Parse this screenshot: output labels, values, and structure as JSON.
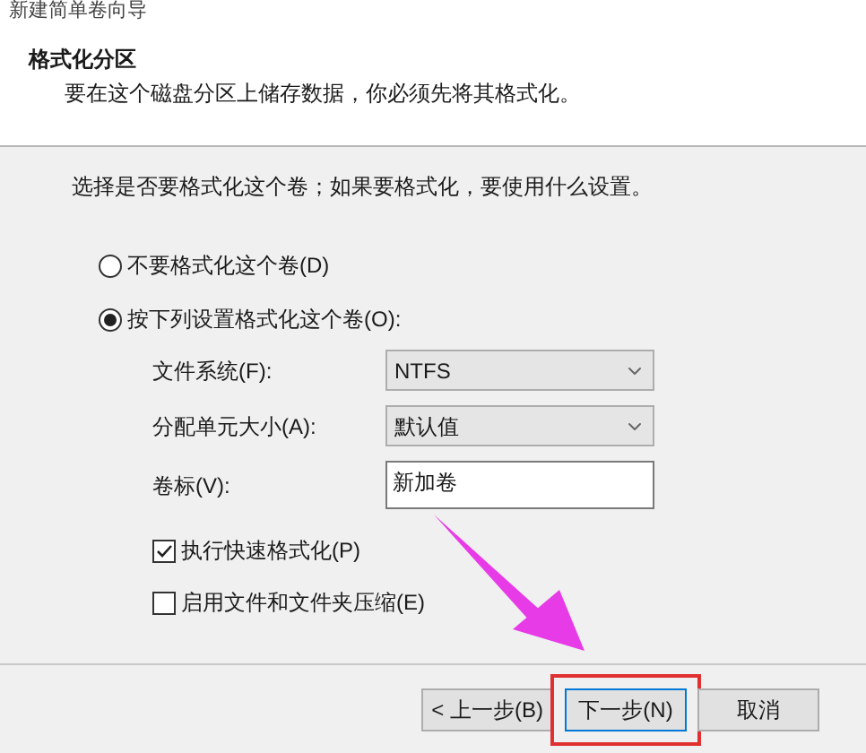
{
  "window": {
    "title": "新建简单卷向导"
  },
  "header": {
    "title": "格式化分区",
    "subtitle": "要在这个磁盘分区上储存数据，你必须先将其格式化。"
  },
  "prompt": "选择是否要格式化这个卷；如果要格式化，要使用什么设置。",
  "options": [
    {
      "label": "不要格式化这个卷(D)",
      "selected": false
    },
    {
      "label": "按下列设置格式化这个卷(O):",
      "selected": true
    }
  ],
  "fields": [
    {
      "kind": "select",
      "label": "文件系统(F):",
      "value": "NTFS"
    },
    {
      "kind": "select",
      "label": "分配单元大小(A):",
      "value": "默认值"
    },
    {
      "kind": "text",
      "label": "卷标(V):",
      "value": "新加卷"
    }
  ],
  "checkboxes": [
    {
      "label": "执行快速格式化(P)",
      "checked": true
    },
    {
      "label": "启用文件和文件夹压缩(E)",
      "checked": false
    }
  ],
  "buttons": [
    {
      "label": "< 上一步(B)",
      "highlighted": false
    },
    {
      "label": "下一步(N)",
      "highlighted": true
    },
    {
      "label": "取消",
      "highlighted": false
    }
  ]
}
